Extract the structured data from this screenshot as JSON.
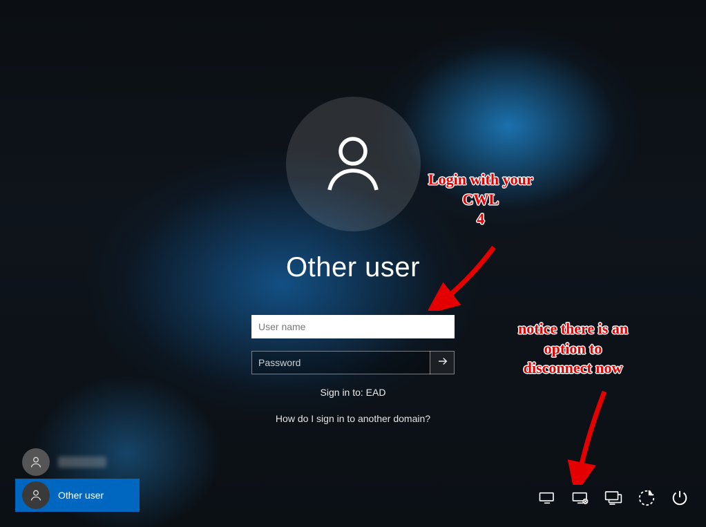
{
  "login": {
    "title": "Other user",
    "username_placeholder": "User name",
    "username_value": "",
    "password_placeholder": "Password",
    "password_value": "",
    "signin_to": "Sign in to: EAD",
    "domain_help": "How do I sign in to another domain?"
  },
  "user_list": {
    "items": [
      {
        "label_redacted": true
      },
      {
        "label": "Other user",
        "selected": true
      }
    ]
  },
  "corner_icons": {
    "network": "network-icon",
    "disconnect": "disconnect-icon",
    "switch": "switch-desktop-icon",
    "ease": "ease-of-access-icon",
    "power": "power-icon"
  },
  "annotations": {
    "a1": "Login with your\nCWL\n4",
    "a2": "notice there is an\noption to\ndisconnect now"
  }
}
